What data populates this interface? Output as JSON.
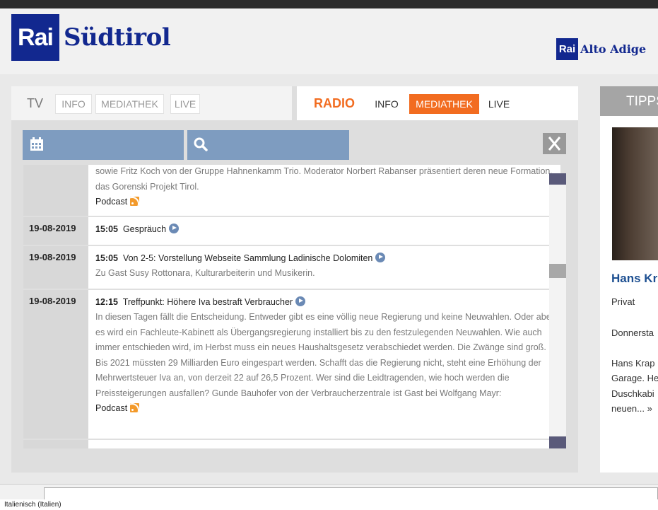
{
  "header": {
    "logo_box": "Rai",
    "logo_text": "Südtirol",
    "logo2_box": "Rai",
    "logo2_text": "Alto Adige"
  },
  "tv_tabs": {
    "title": "TV",
    "items": [
      "INFO",
      "MEDIATHEK",
      "LIVE"
    ]
  },
  "radio_tabs": {
    "title": "RADIO",
    "items": [
      "INFO",
      "MEDIATHEK",
      "LIVE"
    ],
    "active": "MEDIATHEK"
  },
  "search": {
    "calendar_icon": "calendar-icon",
    "search_icon": "search-icon",
    "close_icon": "close-icon"
  },
  "entries": [
    {
      "date": "",
      "time": "",
      "title": "",
      "desc": "sowie Fritz Koch von der Gruppe Hahnenkamm Trio. Moderator Norbert Rabanser präsentiert deren neue Formation, das Gorenski Projekt Tirol.",
      "podcast": "Podcast"
    },
    {
      "date": "19-08-2019",
      "time": "15:05",
      "title": "Gespräuch",
      "desc": "",
      "podcast": ""
    },
    {
      "date": "19-08-2019",
      "time": "15:05",
      "title": "Von 2-5: Vorstellung Webseite Sammlung Ladinische Dolomiten",
      "desc": "Zu Gast Susy Rottonara, Kulturarbeiterin und Musikerin.",
      "podcast": ""
    },
    {
      "date": "19-08-2019",
      "time": "12:15",
      "title": "Treffpunkt: Höhere Iva bestraft Verbraucher",
      "desc": "In diesen Tagen fällt die Entscheidung. Entweder gibt es eine völlig neue Regierung und keine Neuwahlen. Oder aber es wird ein Fachleute-Kabinett als Übergangsregierung installiert bis zu den festzulegenden Neuwahlen. Wie auch immer entschieden wird, im Herbst muss ein neues Haushaltsgesetz verabschiedet werden. Die Zwänge sind groß. Bis 2021 müssten 29 Milliarden Euro eingespart werden. Schafft das die Regierung nicht, steht eine Erhöhung der Mehrwertsteuer Iva an, von derzeit 22 auf 26,5 Prozent. Wer sind die Leidtragenden, wie hoch werden die Preissteigerungen ausfallen? Gunde Bauhofer von der Verbraucherzentrale ist Gast bei Wolfgang Mayr:",
      "podcast": "Podcast"
    }
  ],
  "tipps": {
    "heading": "TIPPS",
    "title": "Hans Kr",
    "line1": "Privat",
    "line2": "Donnersta",
    "line3": "Hans Krap",
    "line4": "Garage. He",
    "line5": "Duschkabi",
    "line6": "neuen... »"
  },
  "statusbar": {
    "text": "Italienisch (Italien)"
  }
}
